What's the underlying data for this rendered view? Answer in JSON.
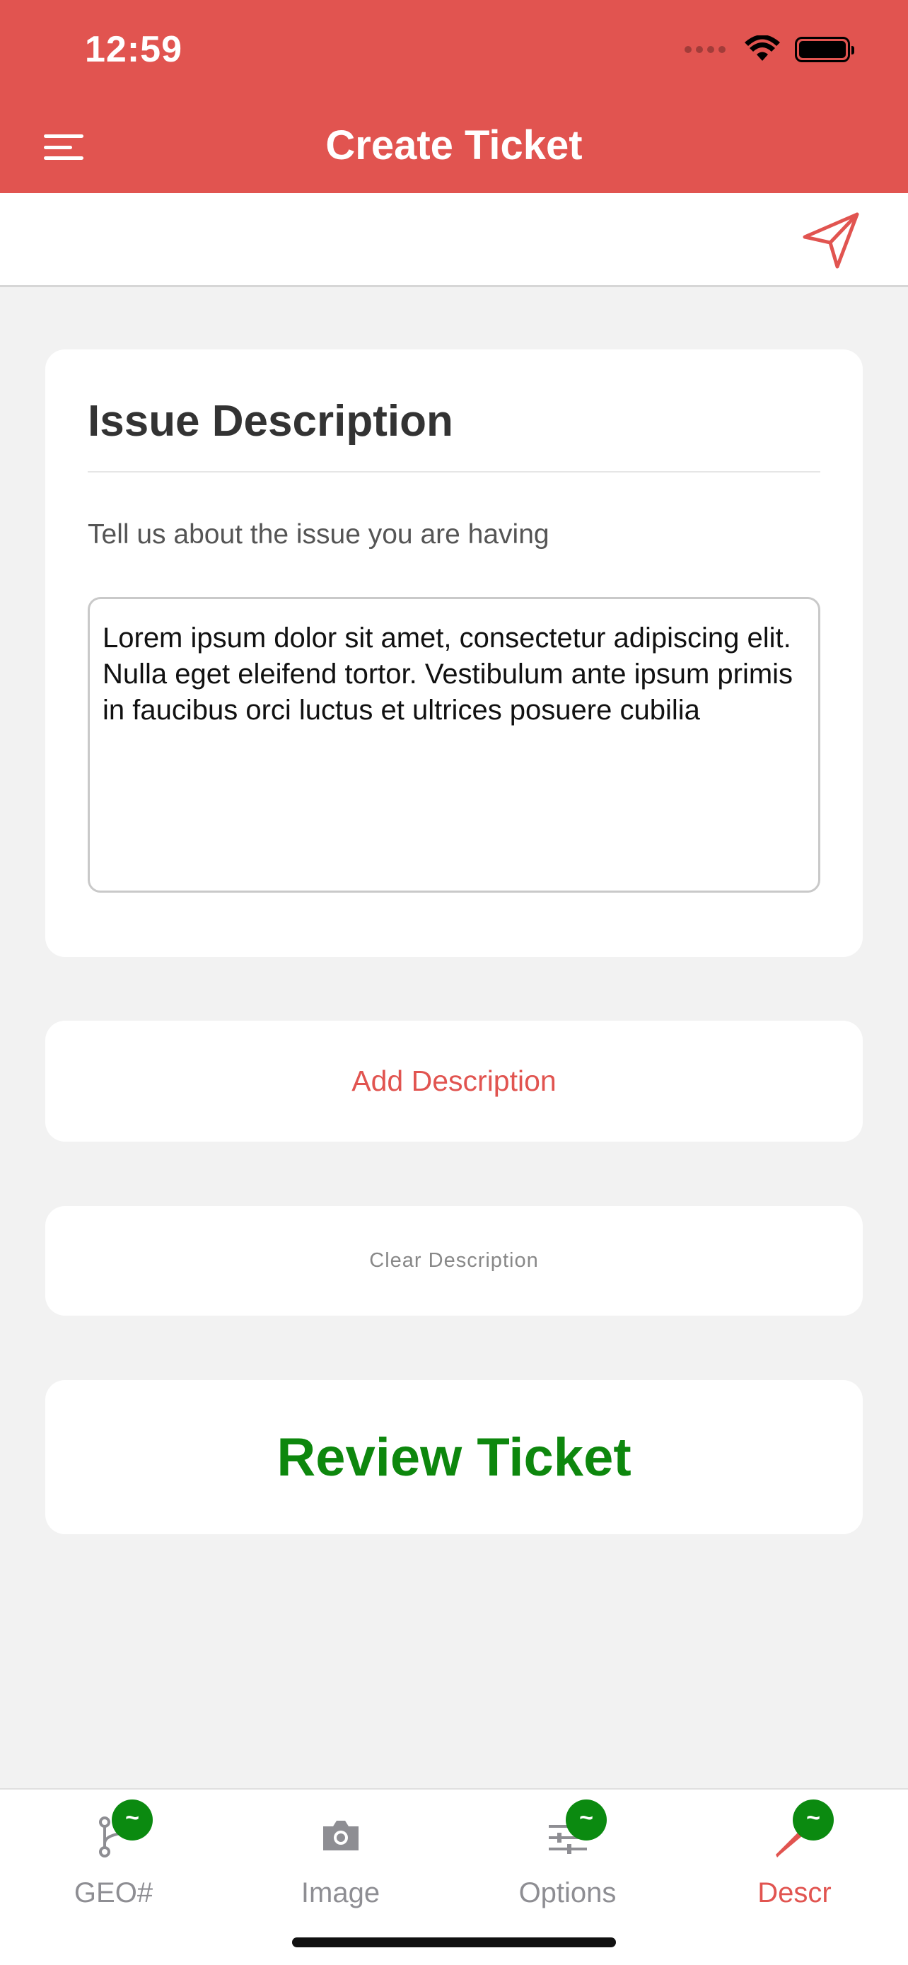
{
  "status_bar": {
    "time": "12:59"
  },
  "header": {
    "title": "Create Ticket",
    "background_color": "#e15450",
    "menu_icon": "hamburger-menu-icon"
  },
  "toolbar": {
    "send_icon": "paper-plane-icon"
  },
  "issue_card": {
    "title": "Issue Description",
    "prompt": "Tell us about the issue you are having",
    "description_value": "Lorem ipsum dolor sit amet, consectetur adipiscing elit. Nulla eget eleifend tortor. Vestibulum ante ipsum primis in faucibus orci luctus et ultrices posuere cubilia"
  },
  "actions": {
    "add_label": "Add Description",
    "clear_label": "Clear Description",
    "review_label": "Review Ticket"
  },
  "colors": {
    "accent": "#e15450",
    "review_green": "#0d870d",
    "badge_green": "#0b8a10",
    "inactive_tab": "#8e8e93"
  },
  "tabs": [
    {
      "label": "GEO#",
      "icon": "geo-branch-icon",
      "badge": "~",
      "active": false
    },
    {
      "label": "Image",
      "icon": "camera-icon",
      "badge": "",
      "active": false
    },
    {
      "label": "Options",
      "icon": "sliders-icon",
      "badge": "~",
      "active": false
    },
    {
      "label": "Descr",
      "icon": "pen-icon",
      "badge": "~",
      "active": true
    }
  ]
}
